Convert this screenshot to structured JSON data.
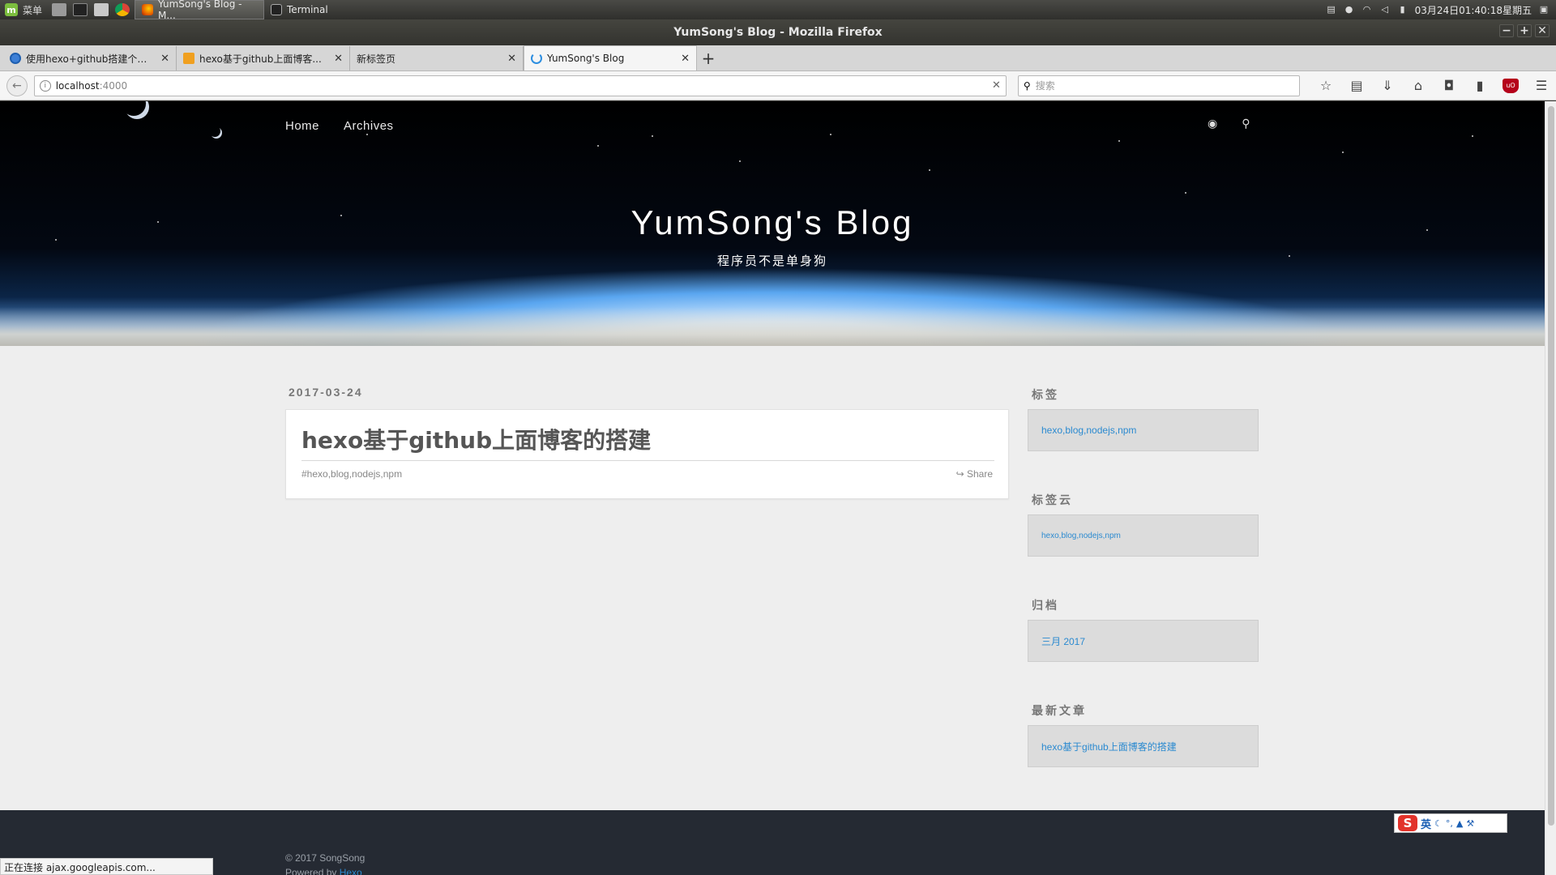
{
  "taskbar": {
    "menu_label": "菜单",
    "tasks": [
      {
        "label": "YumSong's Blog - M..."
      },
      {
        "label": "Terminal"
      }
    ],
    "clock": "03月24日01:40:18星期五"
  },
  "window": {
    "title": "YumSong's Blog - Mozilla Firefox"
  },
  "tabs": [
    {
      "label": "使用hexo+github搭建个人...",
      "favicon": "blue-circle-icon"
    },
    {
      "label": "hexo基于github上面博客...",
      "favicon": "orange-icon"
    },
    {
      "label": "新标签页",
      "favicon": "none"
    },
    {
      "label": "YumSong's Blog",
      "favicon": "loading-spinner-icon"
    }
  ],
  "navbar": {
    "url_host": "localhost",
    "url_port": ":4000",
    "search_placeholder": "搜索"
  },
  "page": {
    "nav": {
      "home": "Home",
      "archives": "Archives"
    },
    "site_title": "YumSong's Blog",
    "site_subtitle": "程序员不是单身狗",
    "post": {
      "date": "2017-03-24",
      "title": "hexo基于github上面博客的搭建",
      "tags": "#hexo,blog,nodejs,npm",
      "share": "Share"
    },
    "widgets": [
      {
        "title": "标签",
        "link": "hexo,blog,nodejs,npm"
      },
      {
        "title": "标签云",
        "link": "hexo,blog,nodejs,npm"
      },
      {
        "title": "归档",
        "link": "三月 2017"
      },
      {
        "title": "最新文章",
        "link": "hexo基于github上面博客的搭建"
      }
    ],
    "footer": {
      "copyright": "© 2017 SongSong",
      "powered_prefix": "Powered by ",
      "powered_link": "Hexo"
    }
  },
  "ime": {
    "mode": "英"
  },
  "statusbar": {
    "text": "正在连接 ajax.googleapis.com..."
  },
  "colors": {
    "link": "#2b8ad0",
    "footer_bg": "#252a33",
    "page_bg": "#eeeeee"
  }
}
